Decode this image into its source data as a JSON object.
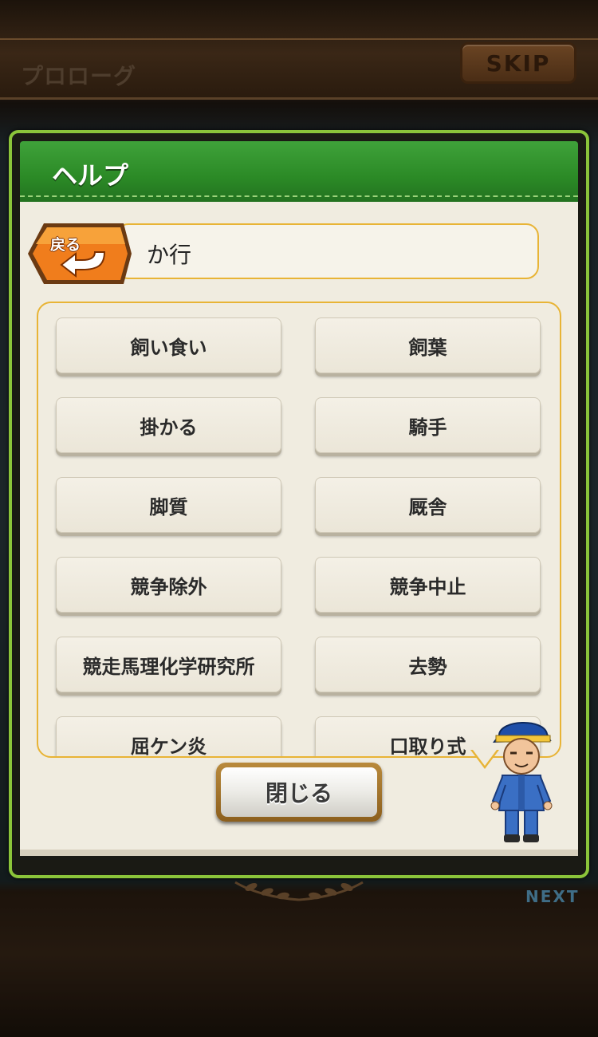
{
  "header": {
    "chapter_title": "プロローグ",
    "skip_label": "SKIP"
  },
  "dialog": {
    "title": "ヘルプ",
    "back_label": "戻る",
    "category": "か行",
    "close_label": "閉じる"
  },
  "terms": [
    {
      "left": "飼い食い",
      "right": "飼葉"
    },
    {
      "left": "掛かる",
      "right": "騎手"
    },
    {
      "left": "脚質",
      "right": "厩舎"
    },
    {
      "left": "競争除外",
      "right": "競争中止"
    },
    {
      "left": "競走馬理化学研究所",
      "right": "去勢"
    },
    {
      "left": "屈ケン炎",
      "right": "口取り式"
    }
  ],
  "footer": {
    "next_label": "NEXT"
  },
  "colors": {
    "header_green": "#2b8a26",
    "dialog_border": "#8bc43a",
    "accent_gold": "#e8b436",
    "back_orange": "#f07d1c"
  }
}
